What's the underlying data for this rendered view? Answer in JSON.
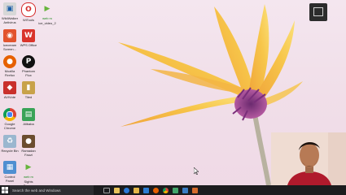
{
  "desktop_icons": [
    {
      "label": "WildWalker Antivirus",
      "icon": "antivirus-icon",
      "color": "#d7d7d7"
    },
    {
      "label": "WiTools",
      "icon": "opera-icon",
      "color": "#d42a2a"
    },
    {
      "label": "ice_video_2",
      "icon": "media-play-icon",
      "color": "#67b43c"
    },
    {
      "label": "Icecream Screen...",
      "icon": "icecream-icon",
      "color": "#e2532d"
    },
    {
      "label": "WPS Office",
      "icon": "wps-office-icon",
      "color": "#d9342b"
    },
    {
      "label": "Mozilla Firefox",
      "icon": "firefox-icon",
      "color": "#e66000"
    },
    {
      "label": "Phantom Flux",
      "icon": "phantom-icon",
      "color": "#111111"
    },
    {
      "label": "AVIVote",
      "icon": "avivote-icon",
      "color": "#c9302c"
    },
    {
      "label": "Tiled",
      "icon": "file-icon",
      "color": "#c8a24a"
    },
    {
      "label": "Google Chrome",
      "icon": "chrome-icon",
      "color": "#3b8de0"
    },
    {
      "label": "Alibaba",
      "icon": "alibaba-icon",
      "color": "#3aa357"
    },
    {
      "label": "Recycle Bin",
      "icon": "recycle-bin-icon",
      "color": "#9ab7cf"
    },
    {
      "label": "Ramadan Fauzi",
      "icon": "photo-icon",
      "color": "#6b4d2f"
    },
    {
      "label": "Control Panel",
      "icon": "control-panel-icon",
      "color": "#4f8fd1"
    },
    {
      "label": "Sights Screen",
      "icon": "web-m-icon",
      "color": "#67b43c"
    }
  ],
  "taskbar": {
    "search_placeholder": "Search the web and Windows",
    "icons": [
      {
        "name": "task-view-icon",
        "color": "#9a9a9a"
      },
      {
        "name": "file-explorer-icon",
        "color": "#e8c25a"
      },
      {
        "name": "edge-icon",
        "color": "#2b78d6"
      },
      {
        "name": "folder-icon",
        "color": "#e3b548"
      },
      {
        "name": "store-icon",
        "color": "#2d7dd2"
      },
      {
        "name": "firefox-icon",
        "color": "#e66000"
      },
      {
        "name": "chrome-icon",
        "color": "#3b8de0"
      },
      {
        "name": "app-green-icon",
        "color": "#44a56a"
      },
      {
        "name": "app-blue-icon",
        "color": "#3a7dc4"
      },
      {
        "name": "app-orange-icon",
        "color": "#d46a2a"
      }
    ]
  },
  "desktop_top_icons": {
    "web_m_label": "web m"
  }
}
